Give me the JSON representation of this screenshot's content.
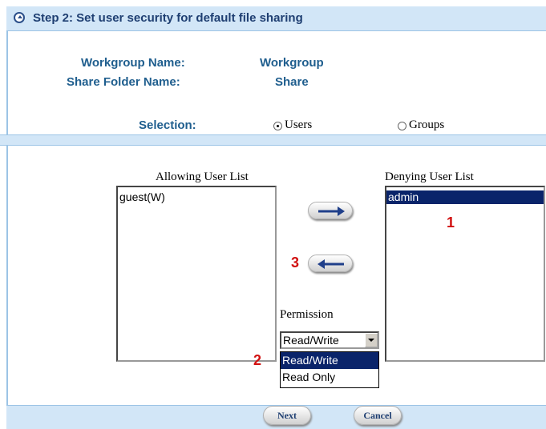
{
  "header": {
    "title": "Step 2: Set user security for default file sharing",
    "icon": "circle-up-arrow-icon"
  },
  "info": {
    "workgroup_label": "Workgroup Name:",
    "workgroup_value": "Workgroup",
    "share_label": "Share Folder Name:",
    "share_value": "Share"
  },
  "selection": {
    "label": "Selection:",
    "options": [
      "Users",
      "Groups"
    ],
    "selected": "Users"
  },
  "allowing_list": {
    "caption": "Allowing User List",
    "items": [
      "guest(W)"
    ]
  },
  "denying_list": {
    "caption": "Denying User List",
    "items": [
      "admin"
    ],
    "selected": "admin"
  },
  "permission": {
    "caption": "Permission",
    "value": "Read/Write",
    "options": [
      "Read/Write",
      "Read Only"
    ]
  },
  "markers": [
    "1",
    "2",
    "3"
  ],
  "buttons": {
    "move_right_icon": "arrow-right-icon",
    "move_left_icon": "arrow-left-icon",
    "next": "Next",
    "cancel": "Cancel"
  },
  "colors": {
    "header_bg": "#d2e6f7",
    "label_text": "#1f5e8e",
    "selection_bg": "#0a246a",
    "marker_red": "#d11010"
  }
}
